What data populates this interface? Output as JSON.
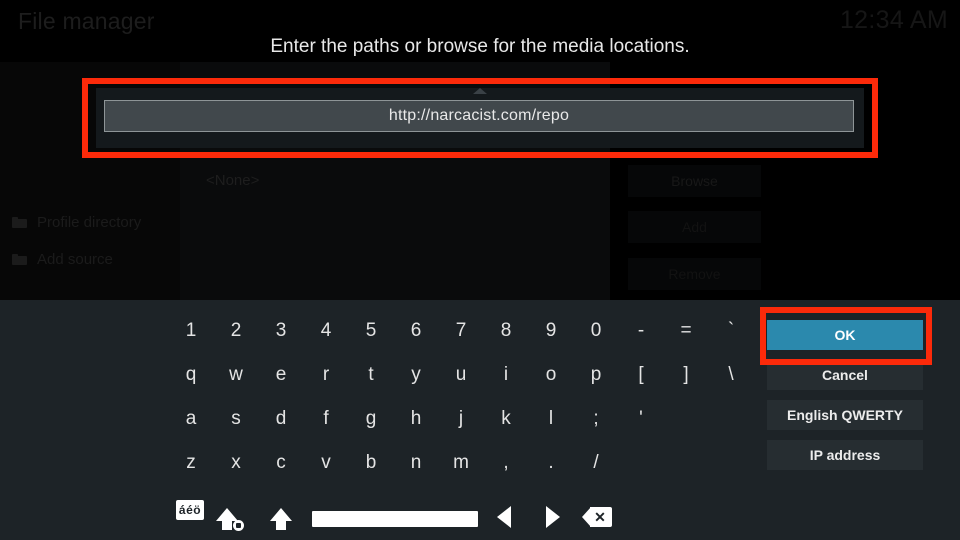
{
  "window": {
    "title": "File manager",
    "clock": "12:34 AM"
  },
  "file_manager": {
    "left_pane_items": [
      {
        "label": "Profile directory",
        "icon": "folder-icon"
      },
      {
        "label": "Add source",
        "icon": "folder-icon"
      }
    ],
    "right_pane_value": "<None>",
    "buttons": [
      {
        "label": "Browse"
      },
      {
        "label": "Add"
      },
      {
        "label": "Remove"
      }
    ]
  },
  "dialog": {
    "heading": "Enter the paths or browse for the media locations.",
    "input": {
      "value": "http://narcacist.com/repo",
      "placeholder": ""
    }
  },
  "keyboard": {
    "rows": [
      [
        "1",
        "2",
        "3",
        "4",
        "5",
        "6",
        "7",
        "8",
        "9",
        "0",
        "-",
        "=",
        "`"
      ],
      [
        "q",
        "w",
        "e",
        "r",
        "t",
        "y",
        "u",
        "i",
        "o",
        "p",
        "[",
        "]",
        "\\"
      ],
      [
        "a",
        "s",
        "d",
        "f",
        "g",
        "h",
        "j",
        "k",
        "l",
        ";",
        "'"
      ],
      [
        "z",
        "x",
        "c",
        "v",
        "b",
        "n",
        "m",
        ",",
        ".",
        "/"
      ]
    ],
    "function_keys": [
      {
        "name": "accents-key",
        "label": "áéö"
      },
      {
        "name": "caps-lock-key",
        "label": ""
      },
      {
        "name": "shift-key",
        "label": ""
      },
      {
        "name": "space-key",
        "label": ""
      },
      {
        "name": "cursor-left-key",
        "label": ""
      },
      {
        "name": "cursor-right-key",
        "label": ""
      },
      {
        "name": "backspace-key",
        "label": "✕"
      }
    ]
  },
  "actions": [
    {
      "label": "OK",
      "primary": true
    },
    {
      "label": "Cancel",
      "primary": false
    },
    {
      "label": "English QWERTY",
      "primary": false
    },
    {
      "label": "IP address",
      "primary": false
    }
  ],
  "annotations": {
    "color": "#fc2a0a",
    "targets": [
      "text-input-field",
      "ok-button"
    ]
  },
  "colors": {
    "accent": "#2b89ad",
    "keyboard_bg": "#1d2327",
    "button_bg": "#262d31",
    "input_bg": "#41484c",
    "highlight": "#fc2a0a"
  }
}
